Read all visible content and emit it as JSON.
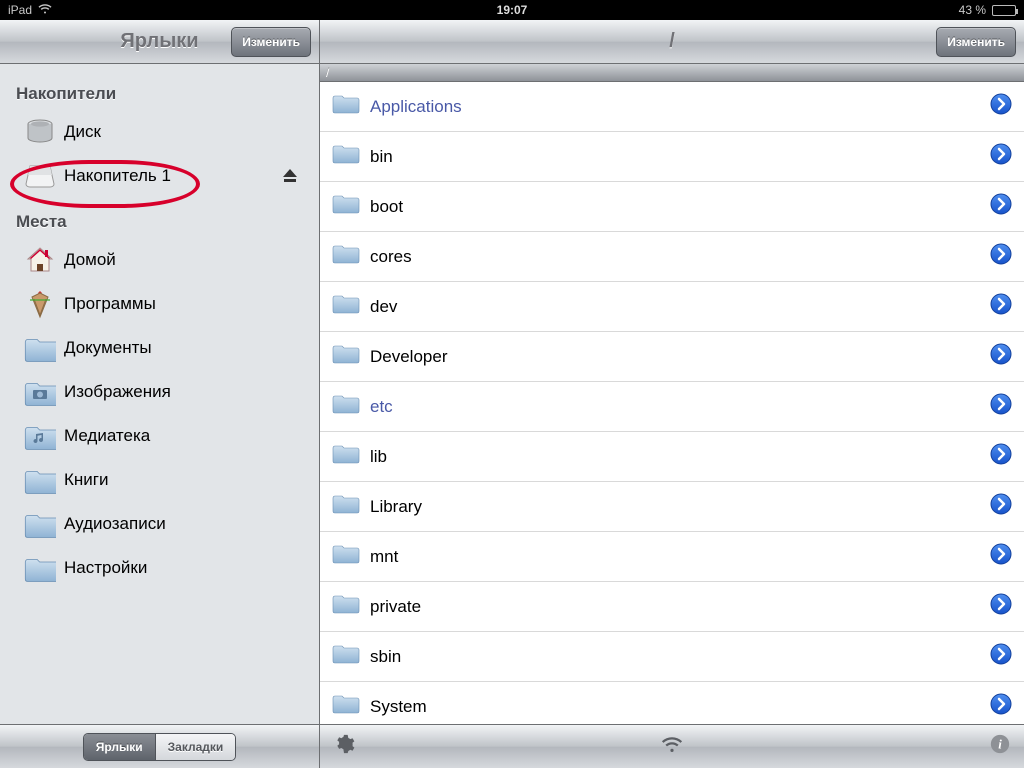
{
  "statusbar": {
    "device": "iPad",
    "time": "19:07",
    "battery_text": "43 %"
  },
  "sidebar": {
    "title": "Ярлыки",
    "edit_label": "Изменить",
    "drives_header": "Накопители",
    "places_header": "Места",
    "drives": [
      {
        "label": "Диск",
        "name": "sidebar-item-disk",
        "icon": "hdd-icon",
        "eject": false
      },
      {
        "label": "Накопитель 1",
        "name": "sidebar-item-drive-1",
        "icon": "drive-icon",
        "eject": true
      }
    ],
    "places": [
      {
        "label": "Домой",
        "name": "sidebar-item-home",
        "icon": "home-icon"
      },
      {
        "label": "Программы",
        "name": "sidebar-item-apps",
        "icon": "apps-icon"
      },
      {
        "label": "Документы",
        "name": "sidebar-item-documents",
        "icon": "folder-icon"
      },
      {
        "label": "Изображения",
        "name": "sidebar-item-images",
        "icon": "folder-images-icon"
      },
      {
        "label": "Медиатека",
        "name": "sidebar-item-media",
        "icon": "folder-music-icon"
      },
      {
        "label": "Книги",
        "name": "sidebar-item-books",
        "icon": "folder-icon"
      },
      {
        "label": "Аудиозаписи",
        "name": "sidebar-item-audio",
        "icon": "folder-icon"
      },
      {
        "label": "Настройки",
        "name": "sidebar-item-settings",
        "icon": "folder-icon"
      }
    ],
    "segmented": {
      "shortcuts": "Ярлыки",
      "bookmarks": "Закладки"
    }
  },
  "main": {
    "title": "/",
    "edit_label": "Изменить",
    "path": "/",
    "items": [
      {
        "name": "Applications",
        "link": true
      },
      {
        "name": "bin",
        "link": false
      },
      {
        "name": "boot",
        "link": false
      },
      {
        "name": "cores",
        "link": false
      },
      {
        "name": "dev",
        "link": false
      },
      {
        "name": "Developer",
        "link": false
      },
      {
        "name": "etc",
        "link": true
      },
      {
        "name": "lib",
        "link": false
      },
      {
        "name": "Library",
        "link": false
      },
      {
        "name": "mnt",
        "link": false
      },
      {
        "name": "private",
        "link": false
      },
      {
        "name": "sbin",
        "link": false
      },
      {
        "name": "System",
        "link": false
      }
    ]
  }
}
